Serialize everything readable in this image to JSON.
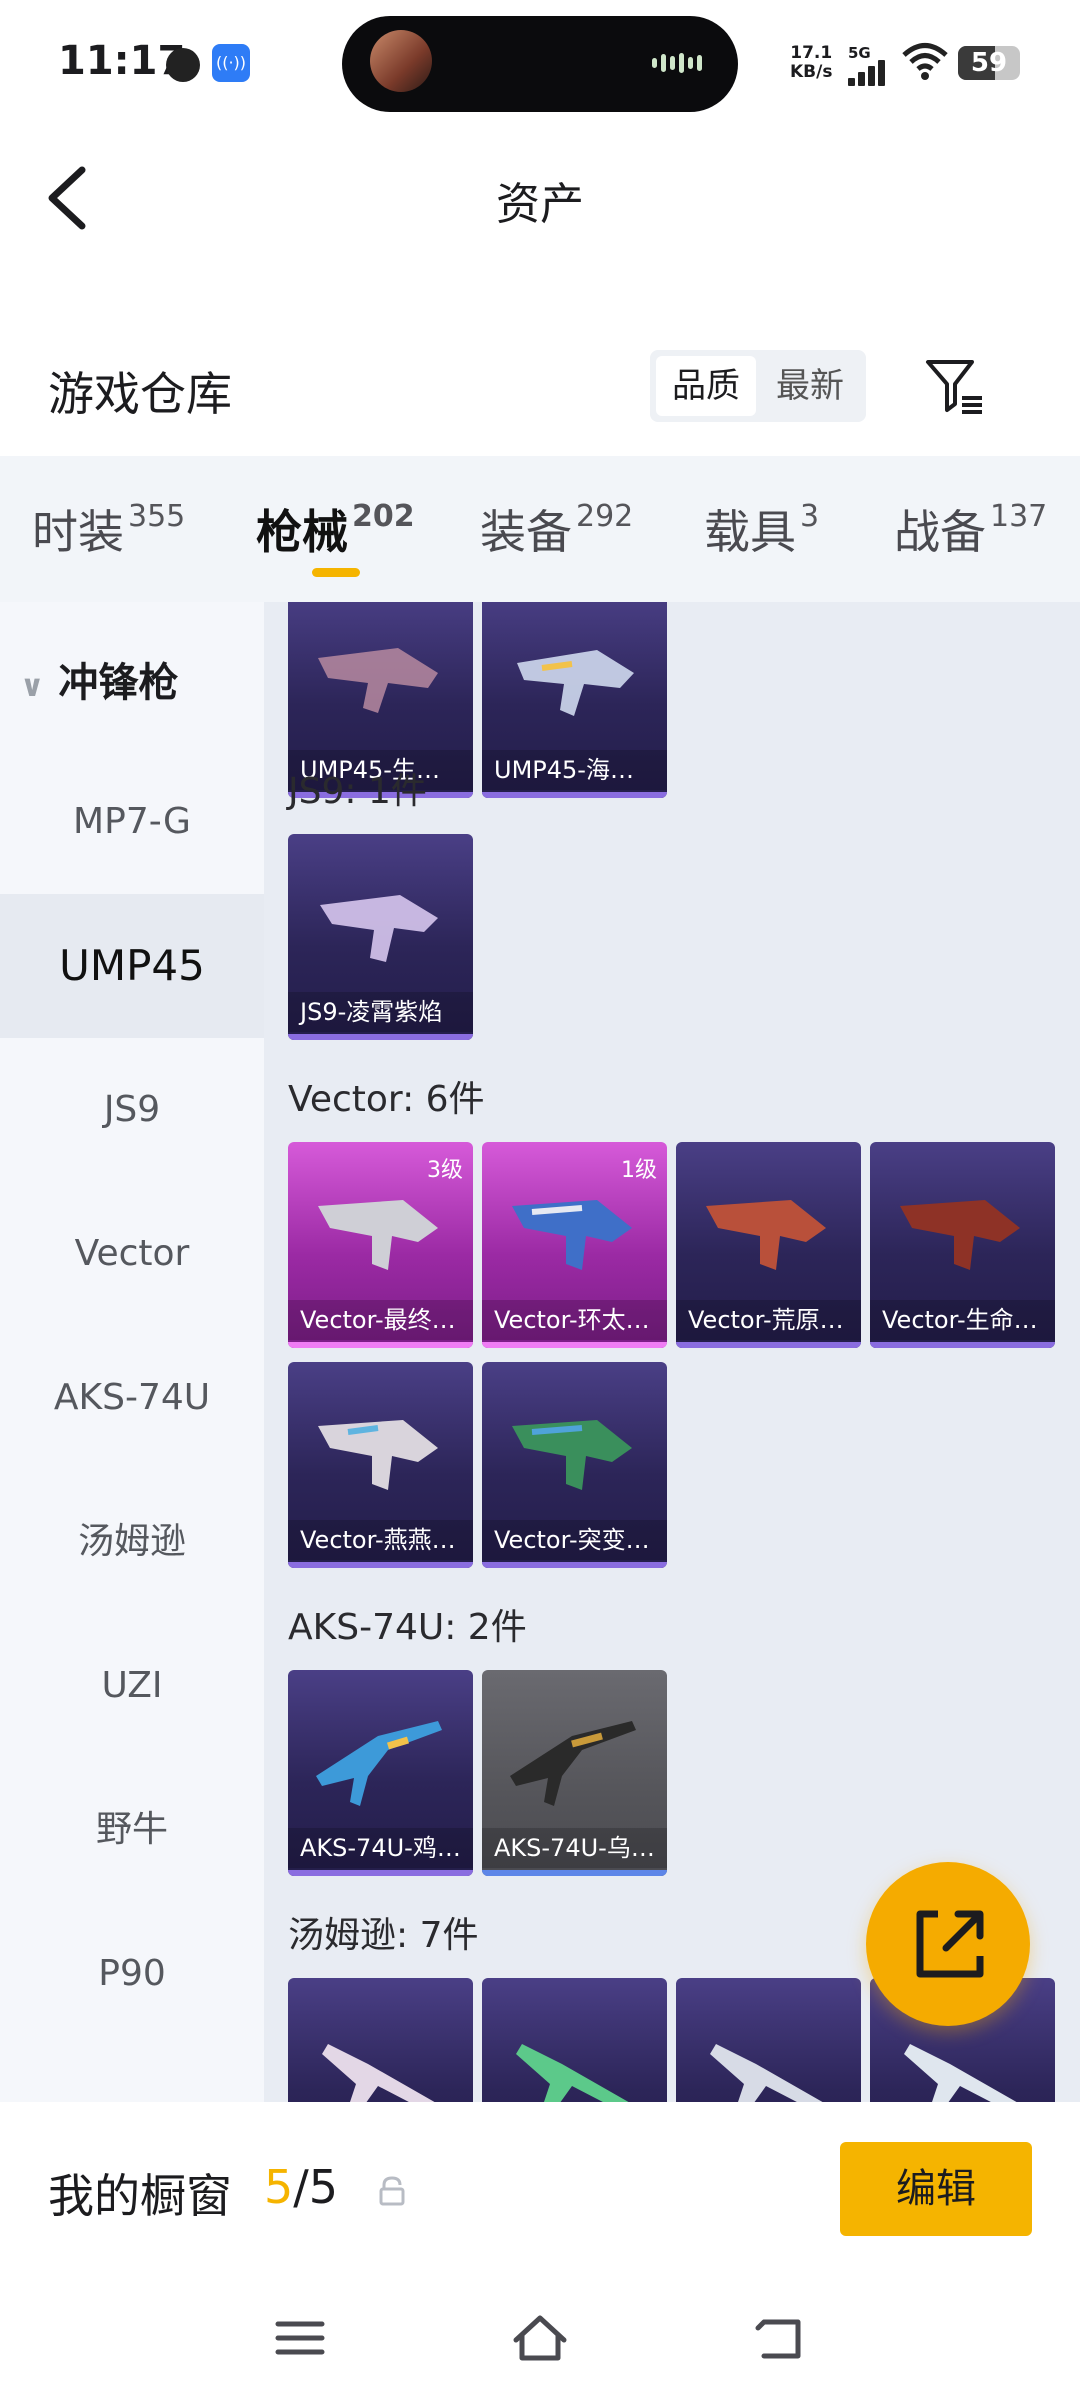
{
  "status_bar": {
    "time": "11:17",
    "net_speed_value": "17.1",
    "net_speed_unit": "KB/s",
    "signal_label": "5G",
    "battery": "59",
    "battery_level": 0.59,
    "icons": [
      "notification-icon",
      "hotspot-icon",
      "signal-icon",
      "wifi-icon",
      "battery-icon"
    ]
  },
  "header": {
    "title": "资产",
    "back_icon": "back-chevron-icon"
  },
  "section": {
    "title": "游戏仓库",
    "sort_options": [
      "品质",
      "最新"
    ],
    "sort_selected": "品质",
    "filter_icon": "filter-icon"
  },
  "tabs": [
    {
      "label": "时装",
      "count": "355"
    },
    {
      "label": "枪械",
      "count": "202",
      "active": true
    },
    {
      "label": "装备",
      "count": "292"
    },
    {
      "label": "载具",
      "count": "3"
    },
    {
      "label": "战备",
      "count": "137"
    }
  ],
  "sidebar": {
    "group": "冲锋枪",
    "items": [
      "MP7-G",
      "UMP45",
      "JS9",
      "Vector",
      "AKS-74U",
      "汤姆逊",
      "UZI",
      "野牛",
      "P90"
    ],
    "selected": "UMP45"
  },
  "groups": [
    {
      "title": "",
      "items": [
        {
          "name": "UMP45-生…",
          "style": "purple"
        },
        {
          "name": "UMP45-海…",
          "style": "purple"
        }
      ]
    },
    {
      "title": "JS9: 1件",
      "items": [
        {
          "name": "JS9-凌霄紫焰",
          "style": "purple"
        }
      ]
    },
    {
      "title": "Vector: 6件",
      "items": [
        {
          "name": "Vector-最终…",
          "level": "3级",
          "style": "pink"
        },
        {
          "name": "Vector-环太…",
          "level": "1级",
          "style": "pink"
        },
        {
          "name": "Vector-荒原…",
          "style": "purple"
        },
        {
          "name": "Vector-生命…",
          "style": "purple"
        },
        {
          "name": "Vector-燕燕…",
          "style": "purple"
        },
        {
          "name": "Vector-突变…",
          "style": "purple"
        }
      ]
    },
    {
      "title": "AKS-74U: 2件",
      "items": [
        {
          "name": "AKS-74U-鸡…",
          "style": "purple"
        },
        {
          "name": "AKS-74U-乌…",
          "style": "gray"
        }
      ]
    },
    {
      "title": "汤姆逊: 7件",
      "items": [
        {
          "name": "",
          "style": "purple"
        },
        {
          "name": "",
          "style": "purple"
        },
        {
          "name": "",
          "style": "purple"
        },
        {
          "name": "",
          "style": "purple"
        }
      ]
    }
  ],
  "fab_icon": "share-external-icon",
  "showcase": {
    "label": "我的橱窗",
    "current": "5",
    "separator": "/",
    "total": "5",
    "edit_label": "编辑",
    "lock_icon": "lock-icon"
  },
  "nav": {
    "menu_icon": "menu-icon",
    "home_icon": "home-icon",
    "back_icon": "return-icon"
  }
}
